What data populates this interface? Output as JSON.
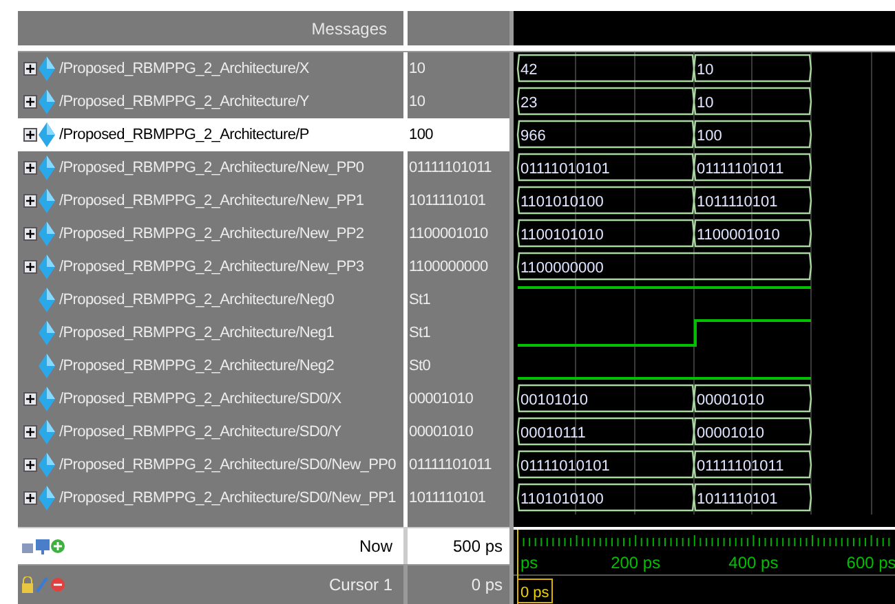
{
  "header": {
    "title": "Messages"
  },
  "signals": [
    {
      "name": "/Proposed_RBMPPG_2_Architecture/X",
      "value": "10",
      "kind": "bus",
      "expandable": true,
      "selected": false,
      "waves": [
        "42",
        "10"
      ]
    },
    {
      "name": "/Proposed_RBMPPG_2_Architecture/Y",
      "value": "10",
      "kind": "bus",
      "expandable": true,
      "selected": false,
      "waves": [
        "23",
        "10"
      ]
    },
    {
      "name": "/Proposed_RBMPPG_2_Architecture/P",
      "value": "100",
      "kind": "bus",
      "expandable": true,
      "selected": true,
      "waves": [
        "966",
        "100"
      ]
    },
    {
      "name": "/Proposed_RBMPPG_2_Architecture/New_PP0",
      "value": "01111101011",
      "kind": "bus",
      "expandable": true,
      "selected": false,
      "waves": [
        "01111010101",
        "01111101011"
      ]
    },
    {
      "name": "/Proposed_RBMPPG_2_Architecture/New_PP1",
      "value": "1011110101",
      "kind": "bus",
      "expandable": true,
      "selected": false,
      "waves": [
        "1101010100",
        "1011110101"
      ]
    },
    {
      "name": "/Proposed_RBMPPG_2_Architecture/New_PP2",
      "value": "1100001010",
      "kind": "bus",
      "expandable": true,
      "selected": false,
      "waves": [
        "1100101010",
        "1100001010"
      ]
    },
    {
      "name": "/Proposed_RBMPPG_2_Architecture/New_PP3",
      "value": "1100000000",
      "kind": "bus",
      "expandable": true,
      "selected": false,
      "waves": [
        "1100000000"
      ]
    },
    {
      "name": "/Proposed_RBMPPG_2_Architecture/Neg0",
      "value": "St1",
      "kind": "bit",
      "expandable": false,
      "selected": false,
      "high": [
        true,
        true
      ]
    },
    {
      "name": "/Proposed_RBMPPG_2_Architecture/Neg1",
      "value": "St1",
      "kind": "bit",
      "expandable": false,
      "selected": false,
      "high": [
        false,
        true
      ]
    },
    {
      "name": "/Proposed_RBMPPG_2_Architecture/Neg2",
      "value": "St0",
      "kind": "bit",
      "expandable": false,
      "selected": false,
      "high": [
        false,
        false
      ]
    },
    {
      "name": "/Proposed_RBMPPG_2_Architecture/SD0/X",
      "value": "00001010",
      "kind": "bus",
      "expandable": true,
      "selected": false,
      "waves": [
        "00101010",
        "00001010"
      ]
    },
    {
      "name": "/Proposed_RBMPPG_2_Architecture/SD0/Y",
      "value": "00001010",
      "kind": "bus",
      "expandable": true,
      "selected": false,
      "waves": [
        "00010111",
        "00001010"
      ]
    },
    {
      "name": "/Proposed_RBMPPG_2_Architecture/SD0/New_PP0",
      "value": "01111101011",
      "kind": "bus",
      "expandable": true,
      "selected": false,
      "waves": [
        "01111010101",
        "01111101011"
      ]
    },
    {
      "name": "/Proposed_RBMPPG_2_Architecture/SD0/New_PP1",
      "value": "1011110101",
      "kind": "bus",
      "expandable": true,
      "selected": false,
      "waves": [
        "1101010100",
        "1011110101"
      ]
    }
  ],
  "now": {
    "label": "Now",
    "value": "500 ps"
  },
  "cursor": {
    "label": "Cursor 1",
    "value": "0 ps",
    "marker": "0 ps"
  },
  "timeline": {
    "ticks": [
      "ps",
      "200 ps",
      "400 ps",
      "600 ps"
    ]
  }
}
